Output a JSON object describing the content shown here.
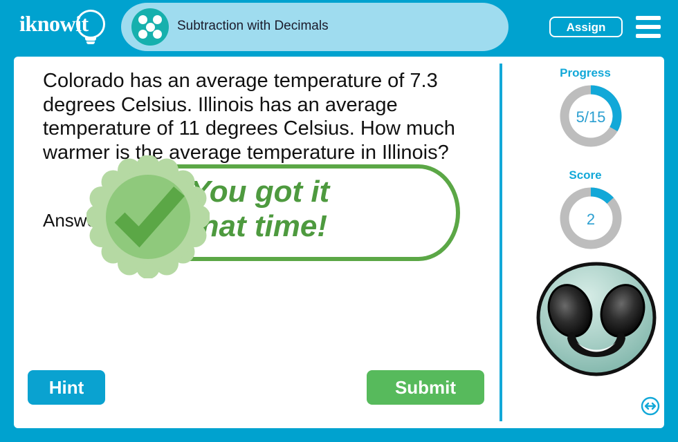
{
  "brand": {
    "logo_text": "iknowit",
    "logo_icon": "lightbulb-icon"
  },
  "header": {
    "topic_title": "Subtraction with Decimals",
    "topic_icon": "five-dots-icon",
    "assign_label": "Assign",
    "menu_icon": "hamburger-menu-icon"
  },
  "question": {
    "text": "Colorado has an average temperature of 7.3 degrees Celsius. Illinois has an average temperature of 11 degrees Celsius. How much warmer is the average temperature in Illinois?",
    "answer_label": "Answer:"
  },
  "feedback": {
    "message": "You got it\nthat time!",
    "badge_icon": "check-mark-badge-icon",
    "badge_color": "#8fc97c",
    "text_color": "#4e9a3f"
  },
  "actions": {
    "hint_label": "Hint",
    "submit_label": "Submit",
    "resize_icon": "resize-horizontal-icon"
  },
  "sidebar": {
    "progress": {
      "title": "Progress",
      "value": "5/15",
      "current": 5,
      "total": 15,
      "percent": 33.3
    },
    "score": {
      "title": "Score",
      "value": "2",
      "percent": 13.3
    },
    "avatar_icon": "alien-avatar-icon"
  },
  "colors": {
    "page_background": "#00a2cf",
    "topic_bar": "#9fdcef",
    "accent_blue": "#12a8d8",
    "gauge_track": "#bdbdbd",
    "submit_green": "#57ba5c",
    "hint_blue": "#0aa2d0"
  }
}
